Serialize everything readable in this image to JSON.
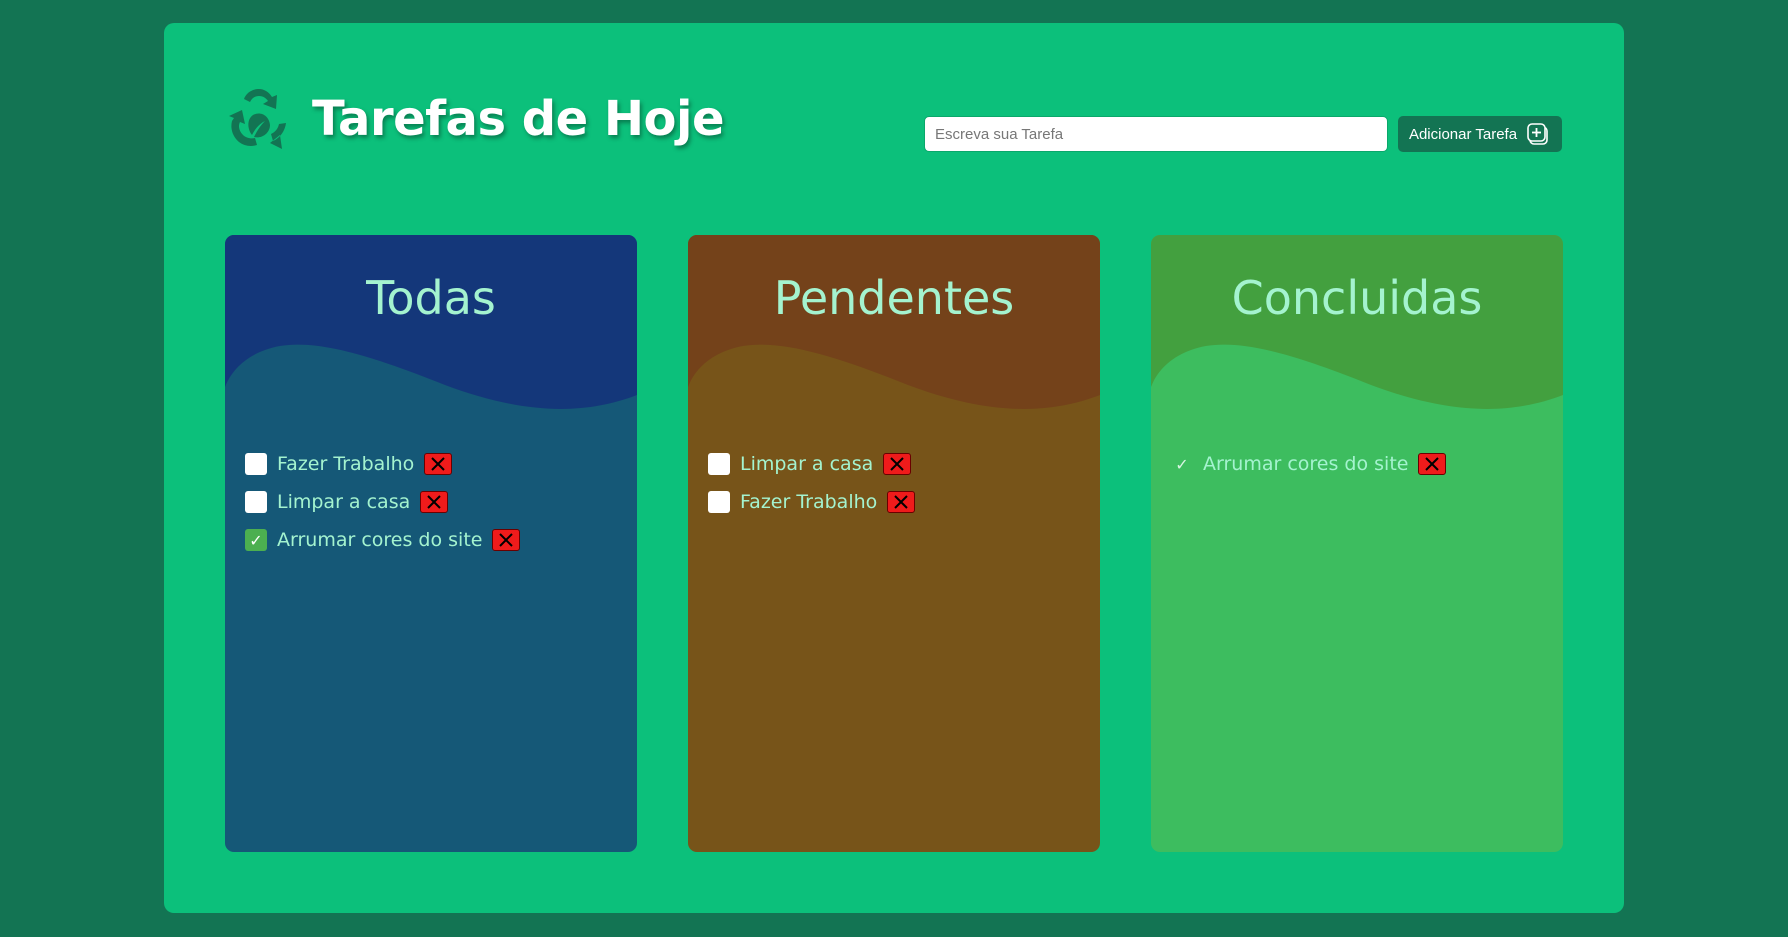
{
  "header": {
    "logo_icon": "recycle-leaf-icon",
    "title": "Tarefas de Hoje"
  },
  "form": {
    "input_value": "",
    "input_placeholder": "Escreva sua Tarefa",
    "add_button_label": "Adicionar Tarefa",
    "add_button_icon": "plus-square-icon"
  },
  "columns": {
    "todas": {
      "title": "Todas",
      "color": "#155877",
      "tasks": [
        {
          "label": "Fazer Trabalho",
          "checked": false
        },
        {
          "label": "Limpar a casa",
          "checked": false
        },
        {
          "label": "Arrumar cores do site",
          "checked": true
        }
      ]
    },
    "pendentes": {
      "title": "Pendentes",
      "color": "#775419",
      "tasks": [
        {
          "label": "Limpar a casa",
          "checked": false
        },
        {
          "label": "Fazer Trabalho",
          "checked": false
        }
      ]
    },
    "concluidas": {
      "title": "Concluidas",
      "color": "#3dbd5f",
      "tasks": [
        {
          "label": "Arrumar cores do site",
          "checked": true
        }
      ]
    }
  },
  "icons": {
    "delete": "close-x-icon",
    "check": "checkmark-icon"
  },
  "colors": {
    "page_background": "#137453",
    "app_background": "#0cc07b",
    "delete_red": "#ef1b1b",
    "text_mint": "#a4f3cf"
  }
}
